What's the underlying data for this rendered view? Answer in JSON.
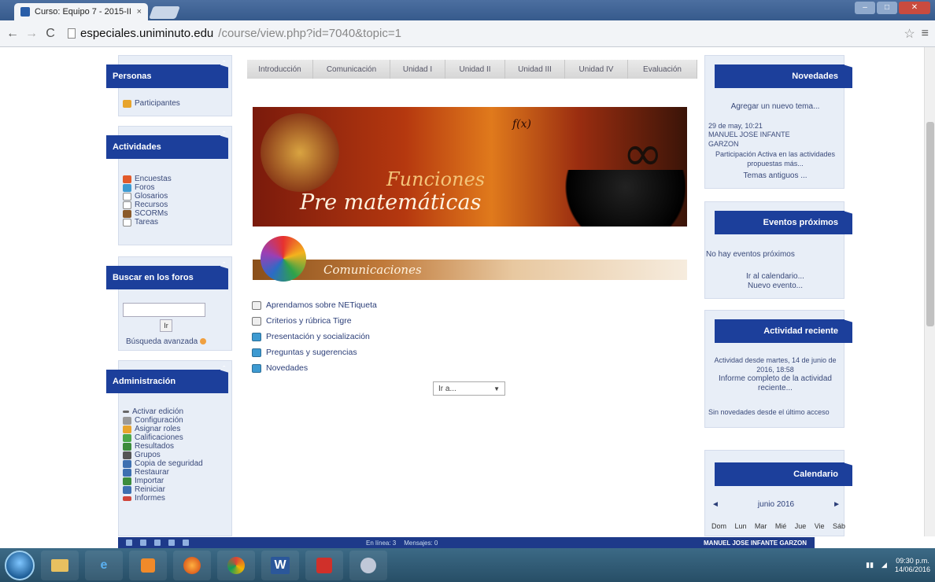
{
  "browser": {
    "tab_title": "Curso: Equipo 7 - 2015-II",
    "tab_close": "×",
    "url_host": "especiales.uniminuto.edu",
    "url_path": "/course/view.php?id=7040&topic=1",
    "back_glyph": "←",
    "forward_glyph": "→",
    "reload_glyph": "C",
    "star_glyph": "☆",
    "menu_glyph": "≡"
  },
  "left": {
    "personas": {
      "title": "Personas",
      "items": [
        "Participantes"
      ]
    },
    "actividades": {
      "title": "Actividades",
      "items": [
        "Encuestas",
        "Foros",
        "Glosarios",
        "Recursos",
        "SCORMs",
        "Tareas"
      ]
    },
    "buscar": {
      "title": "Buscar en los foros",
      "button": "Ir",
      "advanced": "Búsqueda avanzada"
    },
    "admin": {
      "title": "Administración",
      "items": [
        "Activar edición",
        "Configuración",
        "Asignar roles",
        "Calificaciones",
        "Resultados",
        "Grupos",
        "Copia de seguridad",
        "Restaurar",
        "Importar",
        "Reiniciar",
        "Informes"
      ]
    }
  },
  "center": {
    "tabs": [
      "Introducción",
      "Comunicación",
      "Unidad I",
      "Unidad II",
      "Unidad III",
      "Unidad IV",
      "Evaluación"
    ],
    "banner_title1": "Funciones",
    "banner_title2": "Pre matemáticas",
    "banner_symbol": "∞",
    "banner_formula": "f(x)",
    "section_title": "Comunicaciones",
    "forums": [
      "Aprendamos sobre NETiqueta",
      "Criterios y rúbrica Tigre",
      "Presentación y socialización",
      "Preguntas y sugerencias",
      "Novedades"
    ],
    "jump_label": "Ir a...",
    "jump_arrow": "▼"
  },
  "right": {
    "novedades": {
      "title": "Novedades",
      "add_topic": "Agregar un nuevo tema...",
      "post_date": "29 de may, 10:21",
      "post_author": "MANUEL JOSE INFANTE GARZON",
      "post_text": "Participación Activa en las actividades propuestas más...",
      "older": "Temas antiguos ..."
    },
    "eventos": {
      "title": "Eventos próximos",
      "none": "No hay eventos próximos",
      "calendar": "Ir al calendario...",
      "new_event": "Nuevo evento..."
    },
    "actividad": {
      "title": "Actividad reciente",
      "since": "Actividad desde martes, 14 de junio de 2016, 18:58",
      "report": "Informe completo de la actividad reciente...",
      "none": "Sin novedades desde el último acceso"
    },
    "calendario": {
      "title": "Calendario",
      "month": "junio 2016",
      "prev": "◄",
      "next": "►",
      "days": [
        "Dom",
        "Lun",
        "Mar",
        "Mié",
        "Jue",
        "Vie",
        "Sáb"
      ]
    }
  },
  "dock": {
    "online": "En línea: 3",
    "messages": "Mensajes: 0",
    "user": "MANUEL JOSE INFANTE GARZON"
  },
  "taskbar": {
    "time": "09:30 p.m.",
    "date": "14/06/2016"
  },
  "colors": {
    "block_header": "#1c3f9b",
    "link": "#2b3e78",
    "taskbar": "#2f5a74"
  }
}
